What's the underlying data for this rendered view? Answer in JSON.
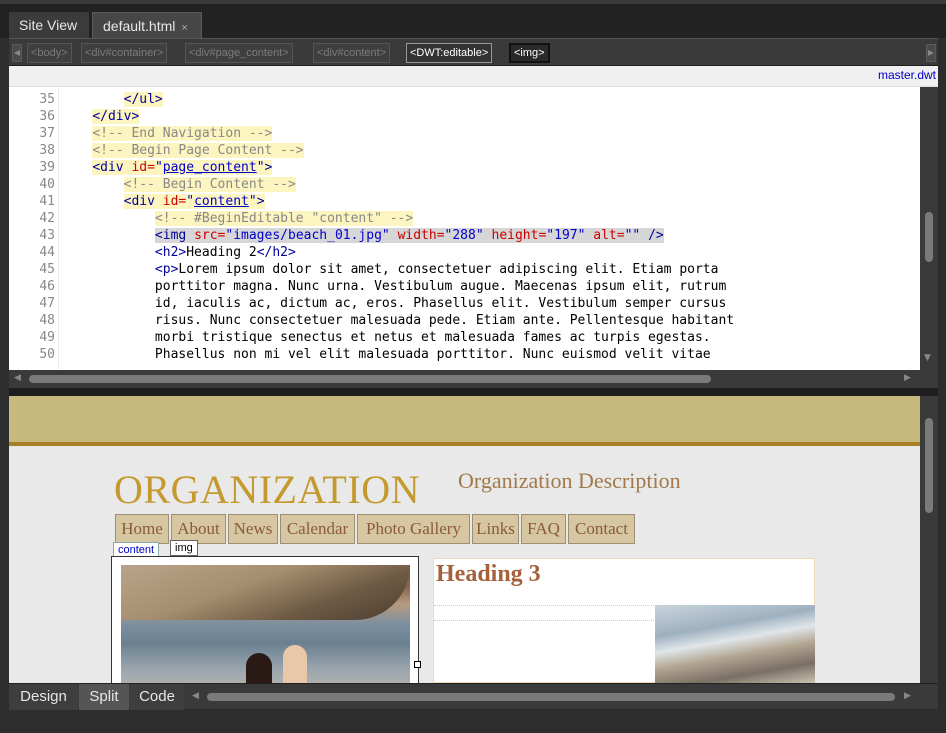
{
  "doc_tabs": {
    "site_view": "Site View",
    "file": "default.html",
    "close_glyph": "×"
  },
  "tag_selector": [
    "<body>",
    "<div#container>",
    "<div#page_content>",
    "<div#content>",
    "<DWT:editable>",
    "<img>"
  ],
  "info_bar": {
    "template_link": "master.dwt"
  },
  "code": {
    "lines": [
      {
        "n": "35",
        "indent": "        ",
        "parts": [
          {
            "c": "tg",
            "t": "</ul>"
          }
        ]
      },
      {
        "n": "36",
        "indent": "    ",
        "parts": [
          {
            "c": "tg",
            "t": "</div>"
          }
        ]
      },
      {
        "n": "37",
        "indent": "    ",
        "parts": [
          {
            "c": "cm",
            "t": "<!-- End Navigation -->"
          }
        ]
      },
      {
        "n": "38",
        "indent": "    ",
        "parts": [
          {
            "c": "cm",
            "t": "<!-- Begin Page Content -->"
          }
        ]
      },
      {
        "n": "39",
        "indent": "    ",
        "parts": [
          {
            "c": "tg",
            "t": "<div "
          },
          {
            "c": "at",
            "t": "id="
          },
          {
            "c": "va",
            "t": "\""
          },
          {
            "c": "lk",
            "t": "page_content"
          },
          {
            "c": "va",
            "t": "\""
          },
          {
            "c": "tg",
            "t": ">"
          }
        ]
      },
      {
        "n": "40",
        "indent": "        ",
        "parts": [
          {
            "c": "cm",
            "t": "<!-- Begin Content -->"
          }
        ]
      },
      {
        "n": "41",
        "indent": "        ",
        "parts": [
          {
            "c": "tg",
            "t": "<div "
          },
          {
            "c": "at",
            "t": "id="
          },
          {
            "c": "va",
            "t": "\""
          },
          {
            "c": "lk",
            "t": "content"
          },
          {
            "c": "va",
            "t": "\""
          },
          {
            "c": "tg",
            "t": ">"
          }
        ]
      },
      {
        "n": "42",
        "indent": "            ",
        "parts": [
          {
            "c": "cm",
            "t": "<!-- #BeginEditable \"content\" -->"
          }
        ]
      },
      {
        "n": "43",
        "indent": "            ",
        "parts": [
          {
            "c": "tg",
            "t": "<img "
          },
          {
            "c": "at",
            "t": "src="
          },
          {
            "c": "va",
            "t": "\"images/beach_01.jpg\" "
          },
          {
            "c": "at",
            "t": "width="
          },
          {
            "c": "va",
            "t": "\"288\" "
          },
          {
            "c": "at",
            "t": "height="
          },
          {
            "c": "va",
            "t": "\"197\" "
          },
          {
            "c": "at",
            "t": "alt="
          },
          {
            "c": "va",
            "t": "\"\" "
          },
          {
            "c": "tg",
            "t": "/>"
          }
        ]
      },
      {
        "n": "44",
        "indent": "            ",
        "parts": [
          {
            "c": "tg",
            "t": "<h2>"
          },
          {
            "c": "tx",
            "t": "Heading 2"
          },
          {
            "c": "tg",
            "t": "</h2>"
          }
        ]
      },
      {
        "n": "45",
        "indent": "            ",
        "parts": [
          {
            "c": "tg",
            "t": "<p>"
          },
          {
            "c": "tx",
            "t": "Lorem ipsum dolor sit amet, consectetuer adipiscing elit. Etiam porta"
          }
        ]
      },
      {
        "n": "46",
        "indent": "            ",
        "parts": [
          {
            "c": "tx",
            "t": "porttitor magna. Nunc urna. Vestibulum augue. Maecenas ipsum elit, rutrum"
          }
        ]
      },
      {
        "n": "47",
        "indent": "            ",
        "parts": [
          {
            "c": "tx",
            "t": "id, iaculis ac, dictum ac, eros. Phasellus elit. Vestibulum semper cursus"
          }
        ]
      },
      {
        "n": "48",
        "indent": "            ",
        "parts": [
          {
            "c": "tx",
            "t": "risus. Nunc consectetuer malesuada pede. Etiam ante. Pellentesque habitant"
          }
        ]
      },
      {
        "n": "49",
        "indent": "            ",
        "parts": [
          {
            "c": "tx",
            "t": "morbi tristique senectus et netus et malesuada fames ac turpis egestas."
          }
        ]
      },
      {
        "n": "50",
        "indent": "            ",
        "parts": [
          {
            "c": "tx",
            "t": "Phasellus non mi vel elit malesuada porttitor. Nunc euismod velit vitae"
          }
        ]
      }
    ]
  },
  "design": {
    "org_name": "ORGANIZATION",
    "org_description": "Organization Description",
    "nav": [
      "Home",
      "About",
      "News",
      "Calendar",
      "Photo Gallery",
      "Links",
      "FAQ",
      "Contact"
    ],
    "region_label": "content",
    "selection_label": "img",
    "heading": "Heading 3"
  },
  "view_buttons": {
    "design": "Design",
    "split": "Split",
    "code": "Code"
  },
  "colors": {
    "accent_gold": "#c49a2e",
    "band": "#c8b97e",
    "nav_bg": "#d6c7a2",
    "heading_brown": "#a6603a"
  },
  "icons": {
    "tag_scroll_left": "left-arrow-icon",
    "tag_scroll_right": "right-arrow-icon"
  }
}
